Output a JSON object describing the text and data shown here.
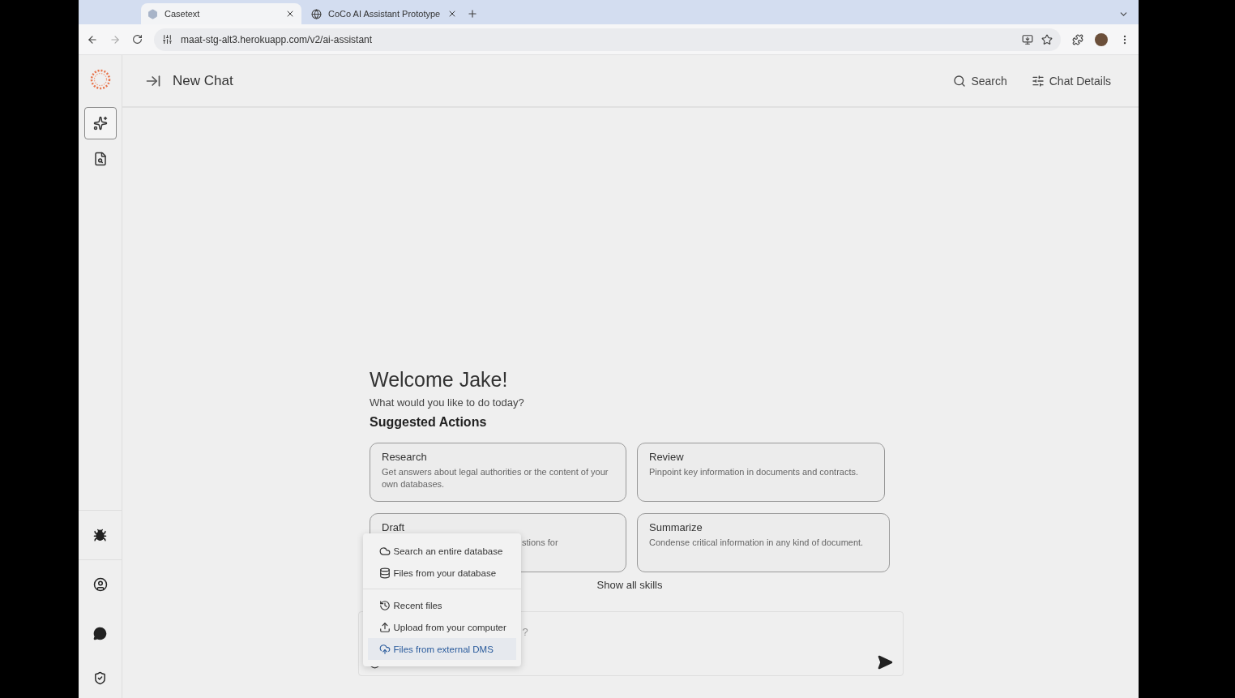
{
  "browser": {
    "tabs": [
      {
        "title": "Casetext",
        "selected": true
      },
      {
        "title": "CoCo AI Assistant Prototype",
        "selected": false
      }
    ],
    "url": "maat-stg-alt3.herokuapp.com/v2/ai-assistant"
  },
  "sidebar": {
    "top_items": [
      {
        "selected": true
      },
      {
        "selected": false
      }
    ]
  },
  "header": {
    "title": "New Chat",
    "actions": [
      "Search",
      "Chat Details"
    ]
  },
  "welcome": {
    "title": "Welcome Jake!",
    "subtitle": "What would you like to do today?",
    "section_heading": "Suggested Actions"
  },
  "cards": [
    {
      "kind": "full",
      "title": "Research",
      "description": "Get answers about legal authorities or the content of your own databases."
    },
    {
      "kind": "full",
      "title": "Review",
      "description": "Pinpoint key information in documents and contracts."
    },
    {
      "kind": "covered",
      "title": "Draft",
      "description": "stions for"
    },
    {
      "kind": "full",
      "title": "Summarize",
      "description": "Condense critical information in any kind of document."
    }
  ],
  "show_all": "Show all skills",
  "composer": {
    "placeholder": "?"
  },
  "menu": {
    "groups": [
      {
        "items": [
          {
            "label": "Search an entire database",
            "selected": false
          },
          {
            "label": "Files from your database",
            "selected": false
          }
        ]
      },
      {
        "items": [
          {
            "label": "Recent files",
            "selected": false
          },
          {
            "label": "Upload from your computer",
            "selected": false
          },
          {
            "label": "Files from external DMS",
            "selected": true
          }
        ]
      }
    ]
  }
}
